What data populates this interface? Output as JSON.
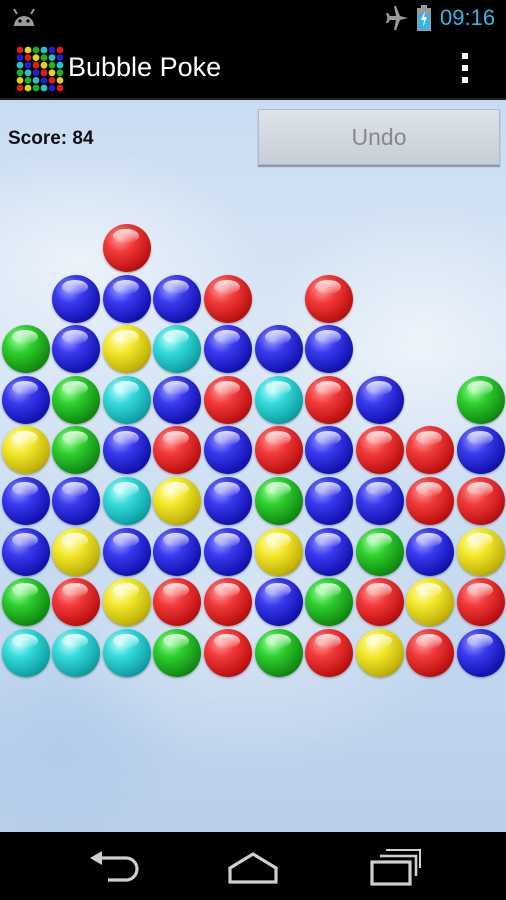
{
  "status_bar": {
    "time": "09:16",
    "icons": [
      "android-notification-icon",
      "airplane-mode-icon",
      "battery-charging-icon"
    ],
    "accent_color": "#33b5e5"
  },
  "action_bar": {
    "title": "Bubble Poke",
    "app_icon": "bubble-grid-app-icon",
    "menu_icon": "overflow-menu-icon"
  },
  "game": {
    "score_label": "Score: 84",
    "undo_label": "Undo",
    "undo_enabled": false,
    "colors": {
      "blue": "#1f1fd0",
      "red": "#dd1c1c",
      "green": "#1fb21f",
      "yellow": "#e4d414",
      "cyan": "#22c4c8"
    },
    "columns": 10,
    "rows": 9,
    "grid": [
      [
        "",
        "",
        "red",
        "",
        "",
        "",
        "",
        "",
        "",
        ""
      ],
      [
        "",
        "blue",
        "blue",
        "blue",
        "red",
        "",
        "red",
        "",
        "",
        ""
      ],
      [
        "green",
        "blue",
        "yellow",
        "cyan",
        "blue",
        "blue",
        "blue",
        "",
        "",
        ""
      ],
      [
        "blue",
        "green",
        "cyan",
        "blue",
        "red",
        "cyan",
        "red",
        "blue",
        "",
        "green"
      ],
      [
        "yellow",
        "green",
        "blue",
        "red",
        "blue",
        "red",
        "blue",
        "red",
        "red",
        "blue"
      ],
      [
        "blue",
        "blue",
        "cyan",
        "yellow",
        "blue",
        "green",
        "blue",
        "blue",
        "red",
        "red"
      ],
      [
        "blue",
        "yellow",
        "blue",
        "blue",
        "blue",
        "yellow",
        "blue",
        "green",
        "blue",
        "yellow"
      ],
      [
        "green",
        "red",
        "yellow",
        "red",
        "red",
        "blue",
        "green",
        "red",
        "yellow",
        "red"
      ],
      [
        "cyan",
        "cyan",
        "cyan",
        "green",
        "red",
        "green",
        "red",
        "yellow",
        "red",
        "blue"
      ]
    ]
  },
  "nav_bar": {
    "buttons": [
      "back-icon",
      "home-icon",
      "recents-icon"
    ]
  }
}
